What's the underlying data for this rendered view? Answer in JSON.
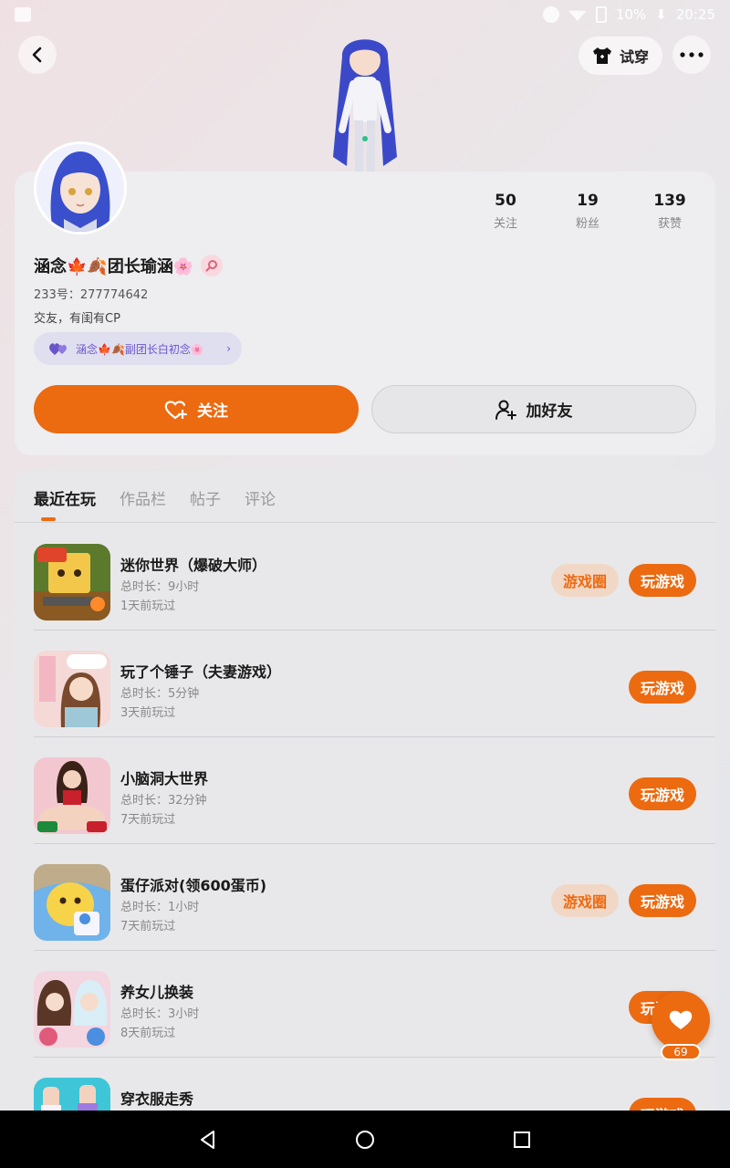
{
  "status_bar": {
    "battery": "10%",
    "time": "20:25"
  },
  "header": {
    "tryon_label": "试穿"
  },
  "profile": {
    "nickname": "涵念🍁🍂团长瑜涵🌸",
    "uid": "233号：277774642",
    "bio": "交友，有闺有CP",
    "cp_label": "涵念🍁🍂副团长白初念🌸",
    "stats": [
      {
        "value": "50",
        "label": "关注"
      },
      {
        "value": "19",
        "label": "粉丝"
      },
      {
        "value": "139",
        "label": "获赞"
      }
    ],
    "follow_label": "关注",
    "add_friend_label": "加好友"
  },
  "tabs": [
    "最近在玩",
    "作品栏",
    "帖子",
    "评论"
  ],
  "games": [
    {
      "name": "迷你世界（爆破大师）",
      "duration": "总时长：9小时",
      "last_played": "1天前玩过",
      "circle": "游戏圈",
      "play": "玩游戏"
    },
    {
      "name": "玩了个锤子（夫妻游戏）",
      "duration": "总时长：5分钟",
      "last_played": "3天前玩过",
      "circle": "",
      "play": "玩游戏"
    },
    {
      "name": "小脑洞大世界",
      "duration": "总时长：32分钟",
      "last_played": "7天前玩过",
      "circle": "",
      "play": "玩游戏"
    },
    {
      "name": "蛋仔派对(领600蛋币)",
      "duration": "总时长：1小时",
      "last_played": "7天前玩过",
      "circle": "游戏圈",
      "play": "玩游戏"
    },
    {
      "name": "养女儿换装",
      "duration": "总时长：3小时",
      "last_played": "8天前玩过",
      "circle": "",
      "play": "玩游戏"
    },
    {
      "name": "穿衣服走秀",
      "duration": "",
      "last_played": "",
      "circle": "",
      "play": "玩游戏"
    }
  ],
  "like_count": "69",
  "colors": {
    "accent": "#ec6a10",
    "accent_soft": "#f1d7c6",
    "cp_purple": "#6b54c9"
  },
  "icons": {
    "back": "back-arrow-icon",
    "more": "more-dots-icon",
    "tryon": "tshirt-icon",
    "follow": "heart-plus-icon",
    "add_friend": "user-plus-icon",
    "like": "heart-icon"
  }
}
